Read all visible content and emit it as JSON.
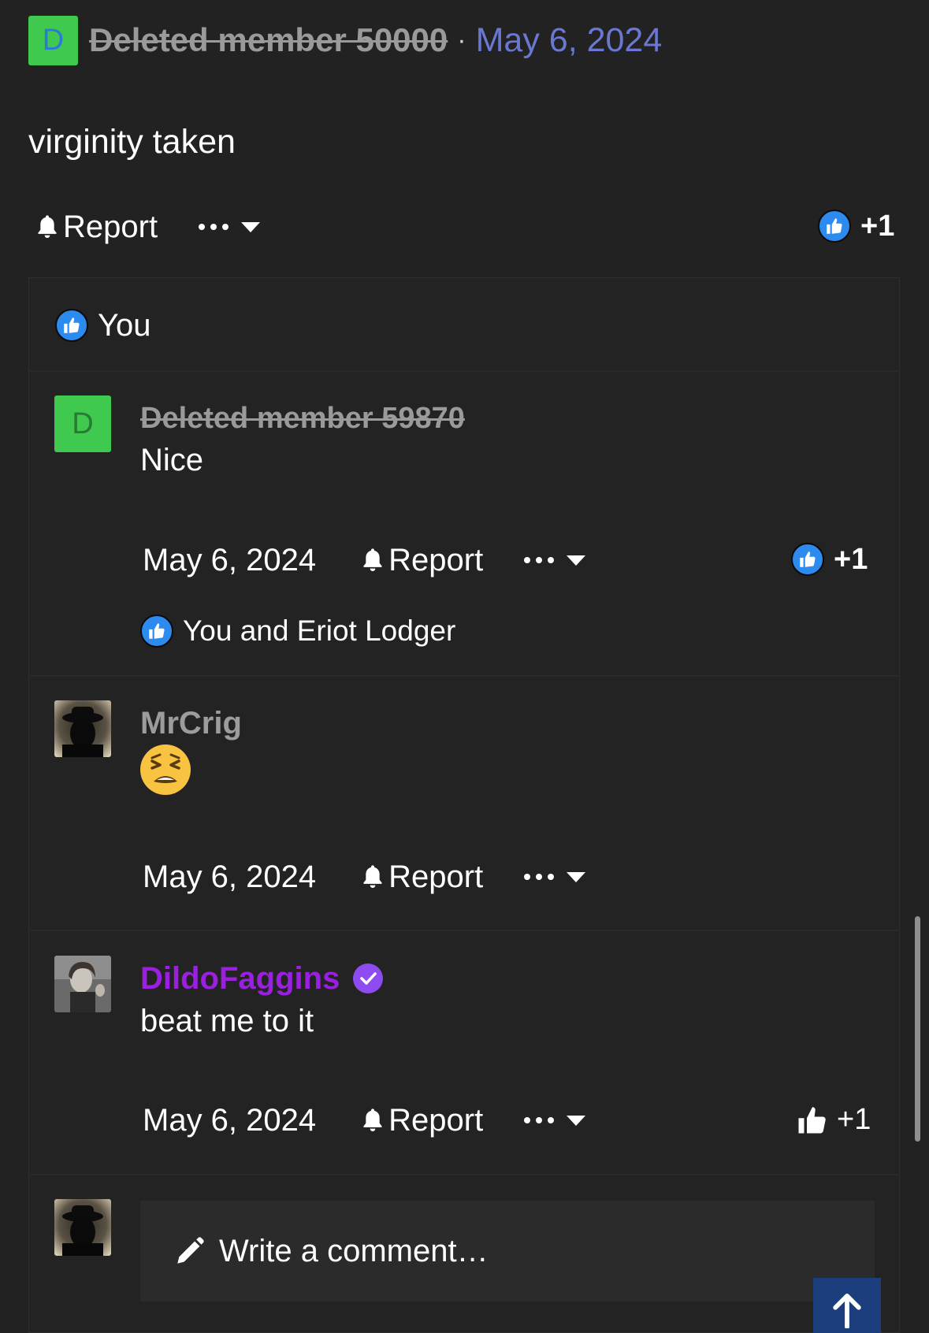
{
  "post": {
    "avatar_letter": "D",
    "avatar_color": "#3fc94e",
    "author": "Deleted member 50000",
    "separator": "·",
    "date": "May 6, 2024",
    "date_color": "#6a78d1",
    "body": "virginity taken",
    "report_label": "Report",
    "like_count": "+1",
    "reactors": "You"
  },
  "comments": [
    {
      "author": "Deleted member 59870",
      "avatar_letter": "D",
      "body": "Nice",
      "date": "May 6, 2024",
      "report_label": "Report",
      "like_count": "+1",
      "reactors": "You and Eriot Lodger"
    },
    {
      "author": "MrCrig",
      "body_emoji": "tired-face-emoji",
      "date": "May 6, 2024",
      "report_label": "Report"
    },
    {
      "author": "DildoFaggins",
      "author_color": "#9b1fe0",
      "verified_icon": "verified-badge-icon",
      "body": "beat me to it",
      "date": "May 6, 2024",
      "report_label": "Report",
      "like_count": "+1"
    }
  ],
  "composer": {
    "placeholder": "Write a comment…",
    "icon": "pencil-icon"
  },
  "scroll_top_icon": "arrow-up-icon",
  "colors": {
    "background": "#222223",
    "like_blue": "#2d8bf0",
    "scroll_top_bg": "#1d3e7c"
  }
}
